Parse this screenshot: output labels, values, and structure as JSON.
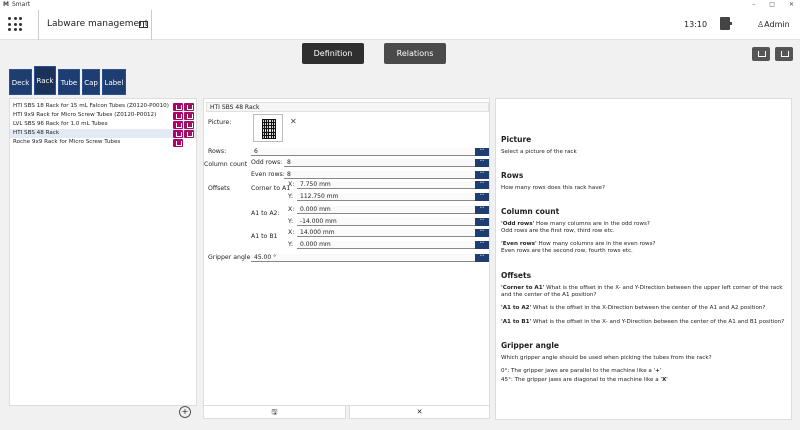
{
  "window": {
    "title": "Smart"
  },
  "header": {
    "title": "Labware management",
    "clock": "13:10",
    "user": "Admin"
  },
  "top_buttons": {
    "definition": "Definition",
    "relations": "Relations"
  },
  "tabs": [
    {
      "label": "Deck"
    },
    {
      "label": "Rack"
    },
    {
      "label": "Tube"
    },
    {
      "label": "Cap"
    },
    {
      "label": "Label"
    }
  ],
  "rack_list": [
    {
      "label": "HTI SBS 18 Rack for 15 mL Falcon Tubes (Z0120-P0010)"
    },
    {
      "label": "HTI 9x9 Rack for Micro Screw Tubes (Z0120-P0012)"
    },
    {
      "label": "LVL SBS 96 Rack for 1.0 mL Tubes"
    },
    {
      "label": "HTI SBS 48 Rack"
    },
    {
      "label": "Roche 9x9 Rack for Micro Screw Tubes"
    }
  ],
  "form": {
    "name": "HTI SBS 48 Rack",
    "picture_label": "Picture:",
    "rows_label": "Rows:",
    "rows_value": "6",
    "column_count_label": "Column count",
    "odd_rows_label": "Odd rows:",
    "odd_rows_value": "8",
    "even_rows_label": "Even rows:",
    "even_rows_value": "8",
    "offsets_label": "Offsets",
    "corner_label": "Corner to A1",
    "corner_x": "7.750 mm",
    "corner_y": "112.750 mm",
    "a1a2_label": "A1 to A2:",
    "a1a2_x": "0.000 mm",
    "a1a2_y": "-14.000 mm",
    "a1b1_label": "A1 to B1",
    "a1b1_x": "14.000 mm",
    "a1b1_y": "0.000 mm",
    "x_label": "X:",
    "y_label": "Y:",
    "gripper_label": "Gripper angle:",
    "gripper_value": "45.00 °"
  },
  "help": {
    "picture_title": "Picture",
    "picture_text": "Select a picture of the rack",
    "rows_title": "Rows",
    "rows_text": "How many rows does this rack have?",
    "column_title": "Column count",
    "odd_rows_key": "'Odd rows'",
    "odd_rows_text1": " How many columns are in the odd rows?",
    "odd_rows_text2": "Odd rows are the first row, third row etc.",
    "even_rows_key": "'Even rows'",
    "even_rows_text1": " How many columns are in the even rows?",
    "even_rows_text2": "Even rows are the second row, fourth rows etc.",
    "offsets_title": "Offsets",
    "corner_key": "'Corner to A1'",
    "corner_text1": " What is the offset in the X- and Y-Direction between the upper left corner of the rack",
    "corner_text2": "and the center of the A1 position?",
    "a1a2_key": "'A1 to A2'",
    "a1a2_text": " What is the offset in the X-Direction between the center of the A1 and A2 position?",
    "a1b1_key": "'A1 to B1'",
    "a1b1_text": " What is the offset in the X- and Y-Direction between the center of the A1 and B1 position?",
    "gripper_title": "Gripper angle",
    "gripper_text": "Which gripper angle should be used when picking the tubes from the rack?",
    "zero_text": "0°: The gripper jaws are parallel to the machine like a '",
    "zero_symbol": "+",
    "fortyfive_text": "45°: The gripper jaws are diagonal to the machine like a '",
    "fortyfive_symbol": "X"
  }
}
